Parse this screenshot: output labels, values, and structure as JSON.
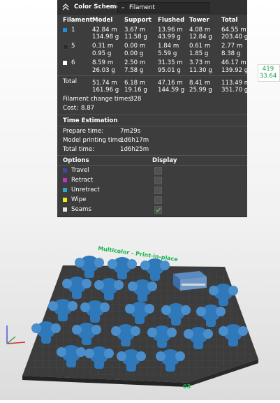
{
  "header": {
    "title": "Color Scheme",
    "scheme_value": "Filament"
  },
  "table": {
    "columns": [
      "Filament",
      "Model",
      "Support",
      "Flushed",
      "Tower",
      "Total"
    ],
    "rows": [
      {
        "id": "1",
        "color": "#1f8ed6",
        "model": [
          "42.84 m",
          "134.98 g"
        ],
        "support": [
          "3.67 m",
          "11.58 g"
        ],
        "flushed": [
          "13.96 m",
          "43.99 g"
        ],
        "tower": [
          "4.08 m",
          "12.84 g"
        ],
        "total": [
          "64.55 m",
          "203.40 g"
        ]
      },
      {
        "id": "5",
        "color": "#2b2b2b",
        "model": [
          "0.31 m",
          "0.95 g"
        ],
        "support": [
          "0.00 m",
          "0.00 g"
        ],
        "flushed": [
          "1.84 m",
          "5.59 g"
        ],
        "tower": [
          "0.61 m",
          "1.85 g"
        ],
        "total": [
          "2.77 m",
          "8.38 g"
        ]
      },
      {
        "id": "6",
        "color": "#ffffff",
        "model": [
          "8.59 m",
          "26.03 g"
        ],
        "support": [
          "2.50 m",
          "7.58 g"
        ],
        "flushed": [
          "31.35 m",
          "95.01 g"
        ],
        "tower": [
          "3.73 m",
          "11.30 g"
        ],
        "total": [
          "46.17 m",
          "139.92 g"
        ]
      }
    ],
    "total_row": {
      "label": "Total",
      "model": [
        "51.74 m",
        "161.96 g"
      ],
      "support": [
        "6.18 m",
        "19.16 g"
      ],
      "flushed": [
        "47.16 m",
        "144.59 g"
      ],
      "tower": [
        "8.41 m",
        "25.99 g"
      ],
      "total": [
        "113.49 m",
        "351.70 g"
      ]
    }
  },
  "summary": {
    "change_label": "Filament change times:",
    "change_value": "328",
    "cost_label": "Cost:",
    "cost_value": "8.87"
  },
  "time": {
    "title": "Time Estimation",
    "rows": [
      {
        "label": "Prepare time:",
        "value": "7m29s"
      },
      {
        "label": "Model printing time:",
        "value": "1d6h17m"
      },
      {
        "label": "Total time:",
        "value": "1d6h25m"
      }
    ]
  },
  "options": {
    "title": "Options",
    "display_title": "Display",
    "items": [
      {
        "label": "Travel",
        "color": "#3b4aa8",
        "checked": false
      },
      {
        "label": "Retract",
        "color": "#c333c8",
        "checked": false
      },
      {
        "label": "Unretract",
        "color": "#2fa7c9",
        "checked": false
      },
      {
        "label": "Wipe",
        "color": "#f2e61c",
        "checked": false
      },
      {
        "label": "Seams",
        "color": "#e6e6e6",
        "checked": true
      }
    ]
  },
  "side_readout": {
    "top": "419",
    "bottom": "33.64"
  },
  "plate": {
    "label": "Multicolor - Print-in-place",
    "plate_number": "03",
    "model_color": "#2f78ba"
  }
}
